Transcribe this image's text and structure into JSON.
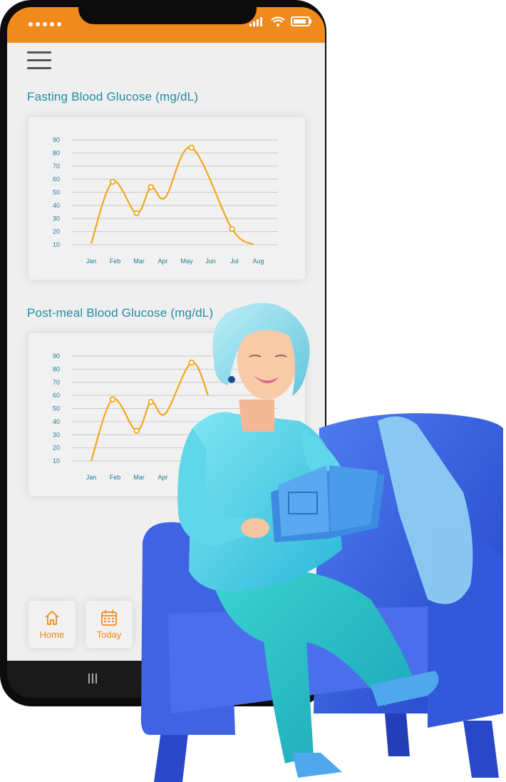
{
  "screen": {
    "chart1_title": "Fasting Blood Glucose (mg/dL)",
    "chart2_title": "Post-meal Blood Glucose (mg/dL)"
  },
  "nav": {
    "home_label": "Home",
    "today_label": "Today"
  },
  "colors": {
    "accent": "#f08a1c",
    "title": "#1e8ca3",
    "line": "#f4a51c"
  },
  "chart_data": [
    {
      "type": "line",
      "title": "Fasting Blood Glucose (mg/dL)",
      "categories": [
        "Jan",
        "Feb",
        "Mar",
        "Apr",
        "May",
        "Jun",
        "Jul",
        "Aug"
      ],
      "yticks": [
        10,
        20,
        30,
        40,
        50,
        60,
        70,
        80,
        90
      ],
      "ylim": [
        10,
        90
      ],
      "curve_x": [
        0,
        0.9,
        1.9,
        2.5,
        3.1,
        4.2,
        5.9,
        6.8
      ],
      "curve_y": [
        11,
        58,
        34,
        54,
        46,
        84,
        22,
        10
      ],
      "markers_x": [
        0.9,
        1.9,
        2.5,
        4.2,
        5.9
      ],
      "markers_y": [
        58,
        34,
        54,
        84,
        22
      ],
      "grid": true
    },
    {
      "type": "line",
      "title": "Post-meal Blood Glucose (mg/dL)",
      "categories": [
        "Jan",
        "Feb",
        "Mar",
        "Apr"
      ],
      "yticks": [
        10,
        20,
        30,
        40,
        50,
        60,
        70,
        80,
        90
      ],
      "ylim": [
        10,
        90
      ],
      "curve_x": [
        0,
        0.9,
        1.9,
        2.5,
        3.1,
        4.2,
        4.9
      ],
      "curve_y": [
        10,
        57,
        33,
        55,
        46,
        85,
        60
      ],
      "markers_x": [
        0.9,
        1.9,
        2.5,
        4.2
      ],
      "markers_y": [
        57,
        33,
        55,
        85
      ],
      "grid": true
    }
  ]
}
